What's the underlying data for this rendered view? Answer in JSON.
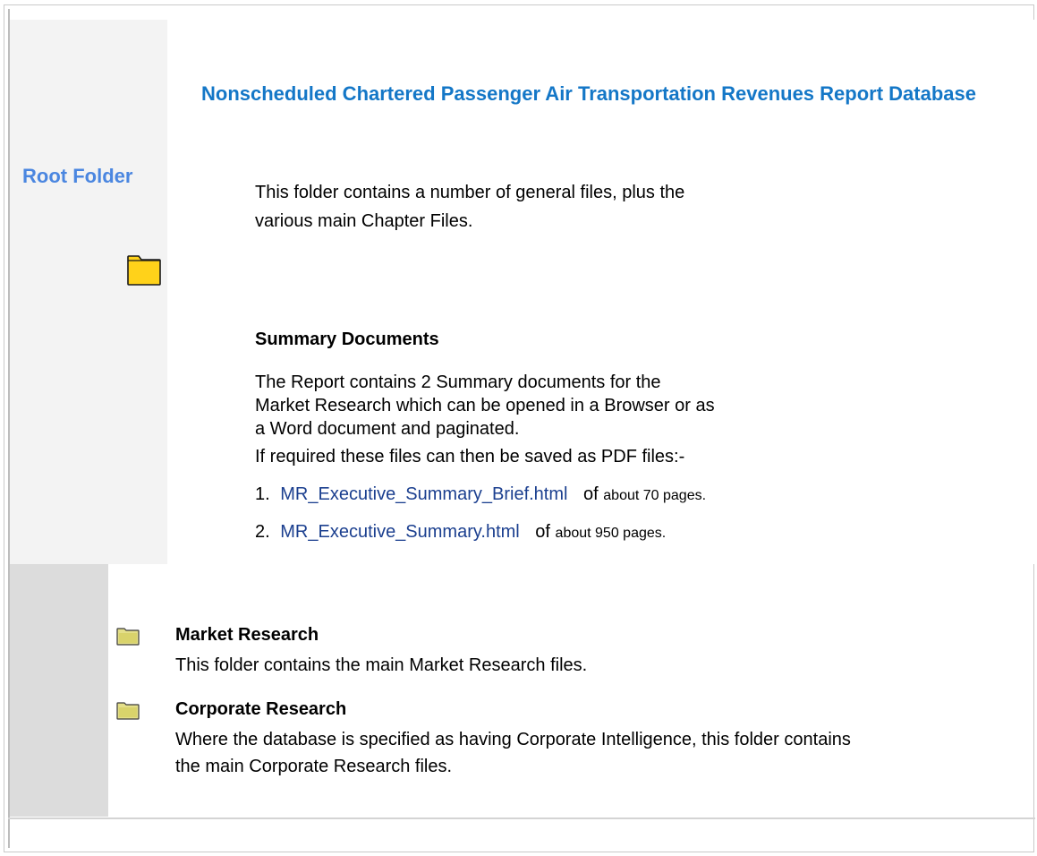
{
  "sidebar": {
    "label": "Root Folder"
  },
  "header": {
    "title": "Nonscheduled Chartered Passenger Air Transportation Revenues Report Database"
  },
  "intro": {
    "text": "This folder contains a number of general files, plus the various main Chapter Files."
  },
  "summary": {
    "heading": "Summary Documents",
    "description": "The Report contains 2 Summary documents for the Market Research which can be opened in a Browser or as a Word document and paginated.",
    "pdf_note": "If required these files can then be saved as PDF files:-",
    "items": [
      {
        "number": "1.",
        "link": "MR_Executive_Summary_Brief.html",
        "of": "of",
        "meta": "about 70 pages."
      },
      {
        "number": "2.",
        "link": "MR_Executive_Summary.html",
        "of": "of",
        "meta": "about 950 pages."
      }
    ]
  },
  "folders": [
    {
      "title": "Market Research",
      "description": "This folder contains the main Market Research files."
    },
    {
      "title": "Corporate Research",
      "description": "Where the database is specified as having Corporate Intelligence, this folder contains the main Corporate Research files."
    }
  ],
  "colors": {
    "accent_title": "#1477c7",
    "accent_label": "#4a86e0",
    "link": "#1b3f8f",
    "folder_yellow": "#ffd21a"
  },
  "icons": {
    "root_folder": "folder-icon",
    "market_folder": "folder-icon",
    "corporate_folder": "folder-icon"
  }
}
